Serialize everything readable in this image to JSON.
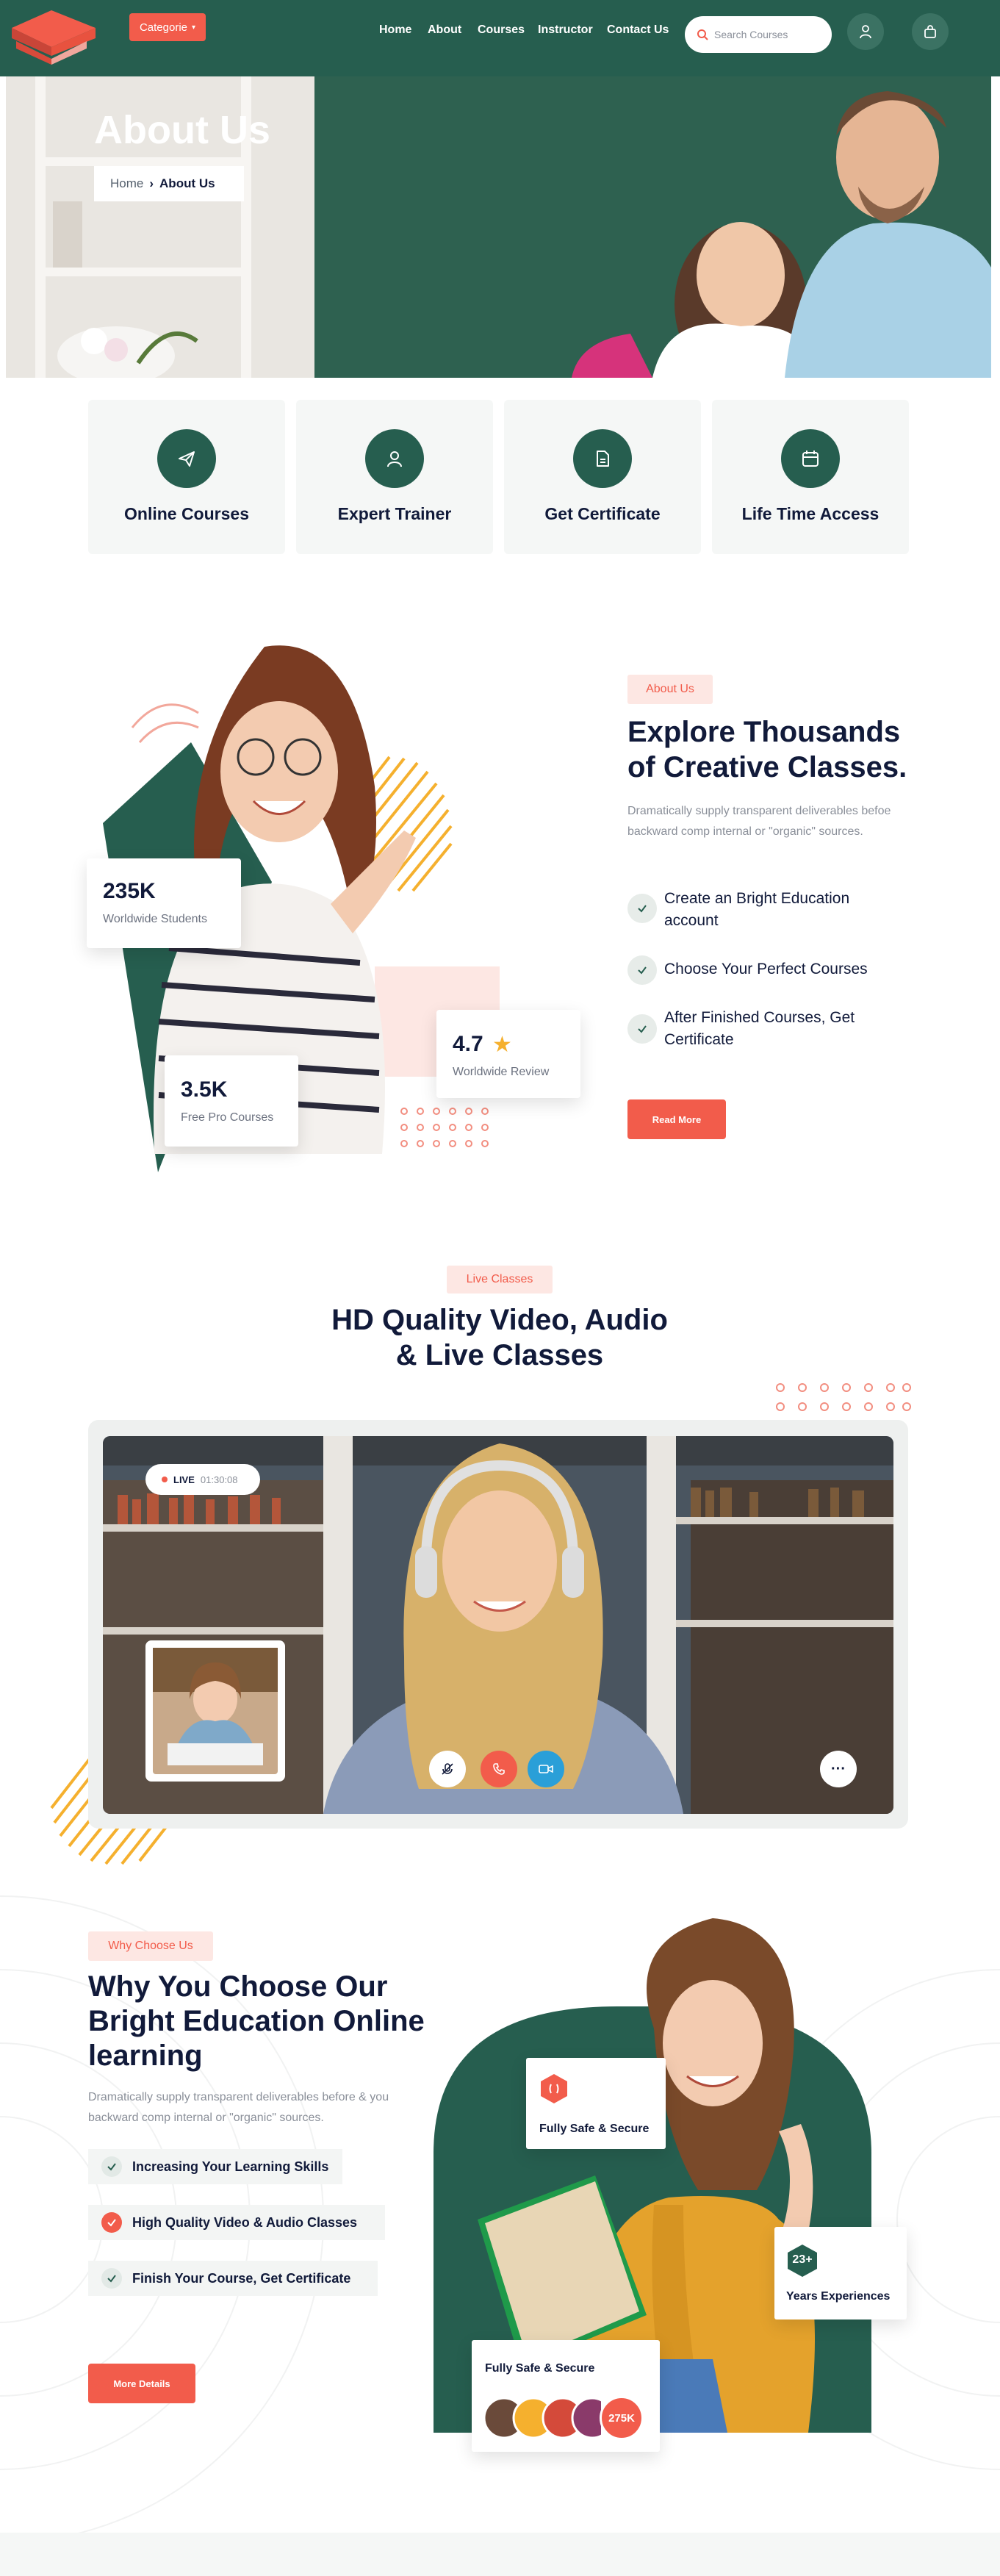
{
  "header": {
    "categorie_label": "Categorie",
    "nav": [
      "Home",
      "About",
      "Courses",
      "Instructor",
      "Contact Us"
    ],
    "search_placeholder": "Search Courses"
  },
  "hero": {
    "title": "About Us",
    "breadcrumb": {
      "home": "Home",
      "current": "About Us"
    }
  },
  "features": [
    {
      "label": "Online Courses",
      "icon": "paper-plane-icon"
    },
    {
      "label": "Expert Trainer",
      "icon": "user-icon"
    },
    {
      "label": "Get Certificate",
      "icon": "document-icon"
    },
    {
      "label": "Life Time Access",
      "icon": "calendar-icon"
    }
  ],
  "about": {
    "tag": "About Us",
    "title_line1": "Explore Thousands",
    "title_line2": "of Creative Classes.",
    "description": "Dramatically supply transparent deliverables befoe backward comp internal or \"organic\" sources.",
    "checks": [
      "Create an Bright Education account",
      "Choose Your Perfect Courses",
      "After Finished Courses, Get Certificate"
    ],
    "button": "Read More",
    "stats": {
      "students_num": "235K",
      "students_cap": "Worldwide Students",
      "courses_num": "3.5K",
      "courses_cap": "Free Pro Courses",
      "review_num": "4.7",
      "review_cap": "Worldwide Review"
    }
  },
  "live": {
    "tag": "Live Classes",
    "title_line1": "HD Quality Video, Audio",
    "title_line2": "& Live Classes",
    "badge": "LIVE",
    "time": "01:30:08"
  },
  "why": {
    "tag": "Why Choose Us",
    "title_line1": "Why You Choose Our",
    "title_line2": "Bright Education Online",
    "title_line3": "learning",
    "description": "Dramatically supply transparent deliverables before & you backward comp internal or \"organic\" sources.",
    "benefits": [
      "Increasing Your Learning Skills",
      "High Quality Video & Audio Classes",
      "Finish Your Course, Get Certificate"
    ],
    "button": "More Details",
    "card_secure": "Fully Safe & Secure",
    "card_years_num": "23+",
    "card_years_cap": "Years Experiences",
    "card_students_title": "Fully Safe & Secure",
    "card_students_count": "275K"
  },
  "colors": {
    "primary": "#265e4f",
    "accent": "#f25c4b",
    "yellow": "#f5b02e",
    "navy": "#111a3a"
  }
}
